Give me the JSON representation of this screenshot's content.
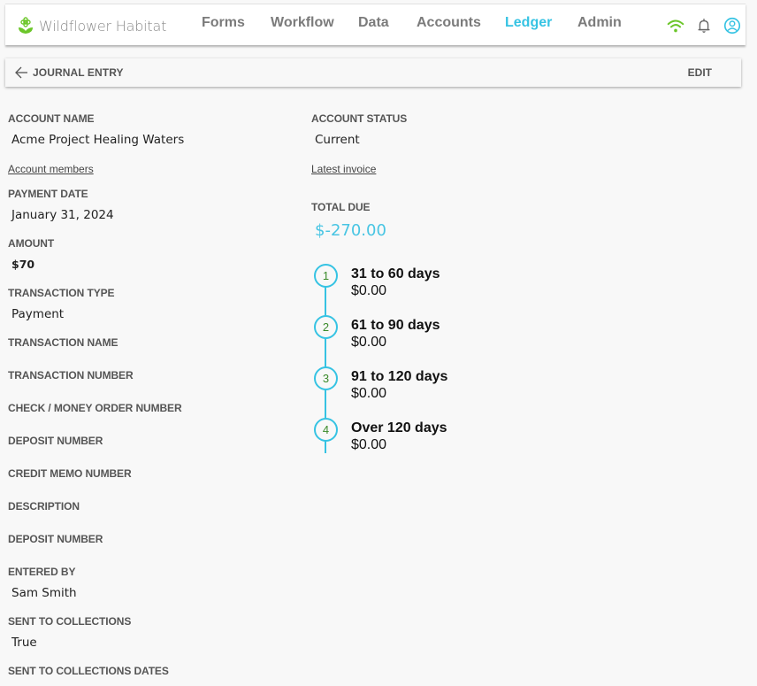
{
  "app": {
    "name": "Wildflower Habitat",
    "brand_color": "#6cc62a",
    "accent_color": "#36c3e3"
  },
  "nav": {
    "items": [
      {
        "label": "Forms",
        "active": false
      },
      {
        "label": "Workflow",
        "active": false
      },
      {
        "label": "Data",
        "active": false
      },
      {
        "label": "Accounts",
        "active": false
      },
      {
        "label": "Ledger",
        "active": true
      },
      {
        "label": "Admin",
        "active": false
      }
    ],
    "icons": [
      "wifi-icon",
      "bell-icon",
      "account-circle-icon"
    ]
  },
  "subheader": {
    "back_icon": "arrow-left-icon",
    "title": "JOURNAL ENTRY",
    "edit_label": "EDIT"
  },
  "left": {
    "account_name": {
      "label": "ACCOUNT NAME",
      "value": "Acme Project Healing Waters"
    },
    "account_members_link": "Account members",
    "payment_date": {
      "label": "PAYMENT DATE",
      "value": "January 31, 2024"
    },
    "amount": {
      "label": "AMOUNT",
      "value": "$70"
    },
    "transaction_type": {
      "label": "TRANSACTION TYPE",
      "value": "Payment"
    },
    "transaction_name": {
      "label": "TRANSACTION NAME",
      "value": ""
    },
    "transaction_number": {
      "label": "TRANSACTION NUMBER",
      "value": ""
    },
    "check_number": {
      "label": "CHECK / MONEY ORDER NUMBER",
      "value": ""
    },
    "deposit_number": {
      "label": "DEPOSIT NUMBER",
      "value": ""
    },
    "credit_memo_number": {
      "label": "CREDIT MEMO NUMBER",
      "value": ""
    },
    "description": {
      "label": "DESCRIPTION",
      "value": ""
    },
    "deposit_number_2": {
      "label": "DEPOSIT NUMBER",
      "value": ""
    },
    "entered_by": {
      "label": "ENTERED BY",
      "value": "Sam Smith"
    },
    "sent_to_collections": {
      "label": "SENT TO COLLECTIONS",
      "value": "True"
    },
    "sent_to_collections_dates": {
      "label": "SENT TO COLLECTIONS DATES",
      "value": ""
    }
  },
  "right": {
    "account_status": {
      "label": "ACCOUNT STATUS",
      "value": "Current"
    },
    "latest_invoice_link": "Latest invoice",
    "total_due": {
      "label": "TOTAL DUE",
      "value": "$-270.00"
    },
    "aging": [
      {
        "step": "1",
        "title": "31 to 60 days",
        "amount": "$0.00"
      },
      {
        "step": "2",
        "title": "61 to 90 days",
        "amount": "$0.00"
      },
      {
        "step": "3",
        "title": "91 to 120 days",
        "amount": "$0.00"
      },
      {
        "step": "4",
        "title": "Over 120 days",
        "amount": "$0.00"
      }
    ]
  }
}
